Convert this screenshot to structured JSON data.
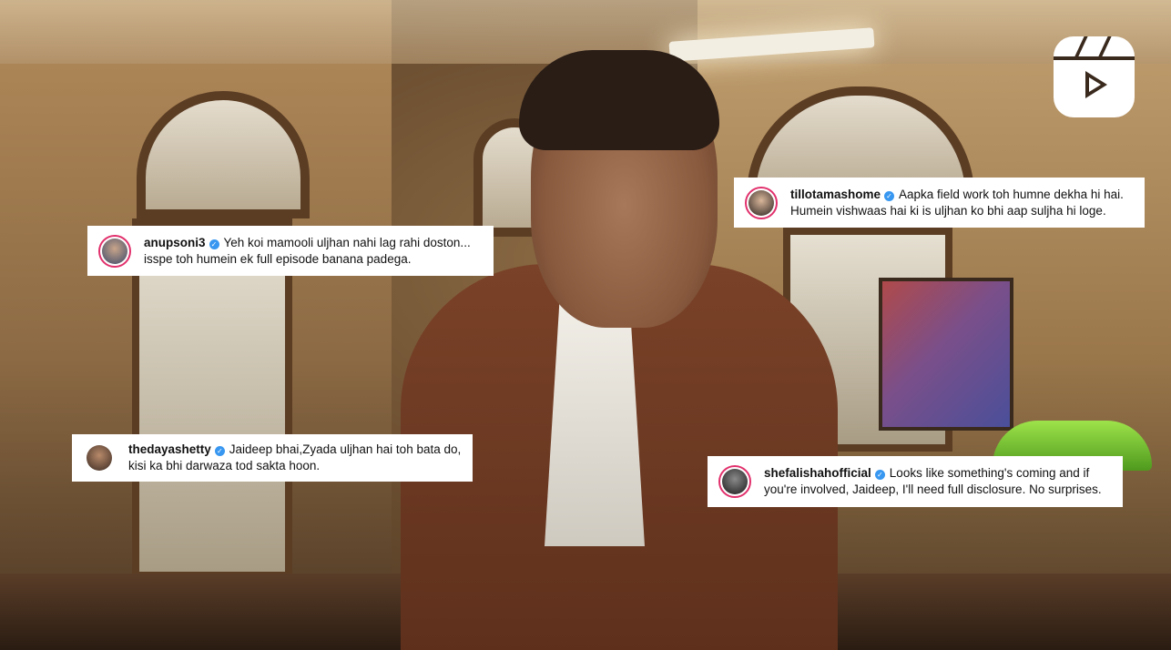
{
  "colors": {
    "verified": "#3897f0",
    "avatar_ring": "#e1306c",
    "comment_bg": "#ffffff"
  },
  "icons": {
    "reels": "reels-icon",
    "verified": "verified-badge-icon"
  },
  "comments": [
    {
      "username": "anupsoni3",
      "verified": true,
      "badge": "✓",
      "line1": "Yeh koi mamooli uljhan nahi lag rahi doston...",
      "line2": "isspe toh humein ek full episode banana padega."
    },
    {
      "username": "tillotamashome",
      "verified": true,
      "badge": "✓",
      "line1": "Aapka field work toh humne dekha hi hai.",
      "line2": "Humein vishwaas hai ki is uljhan ko bhi aap suljha hi loge."
    },
    {
      "username": "thedayashetty",
      "verified": true,
      "badge": "✓",
      "line1": "Jaideep bhai,Zyada uljhan hai toh bata do,",
      "line2": "kisi ka bhi darwaza tod sakta hoon."
    },
    {
      "username": "shefalishahofficial",
      "verified": true,
      "badge": "✓",
      "line1": "Looks like something's coming and if",
      "line2": "you're involved, Jaideep, I'll need full disclosure. No surprises."
    }
  ]
}
